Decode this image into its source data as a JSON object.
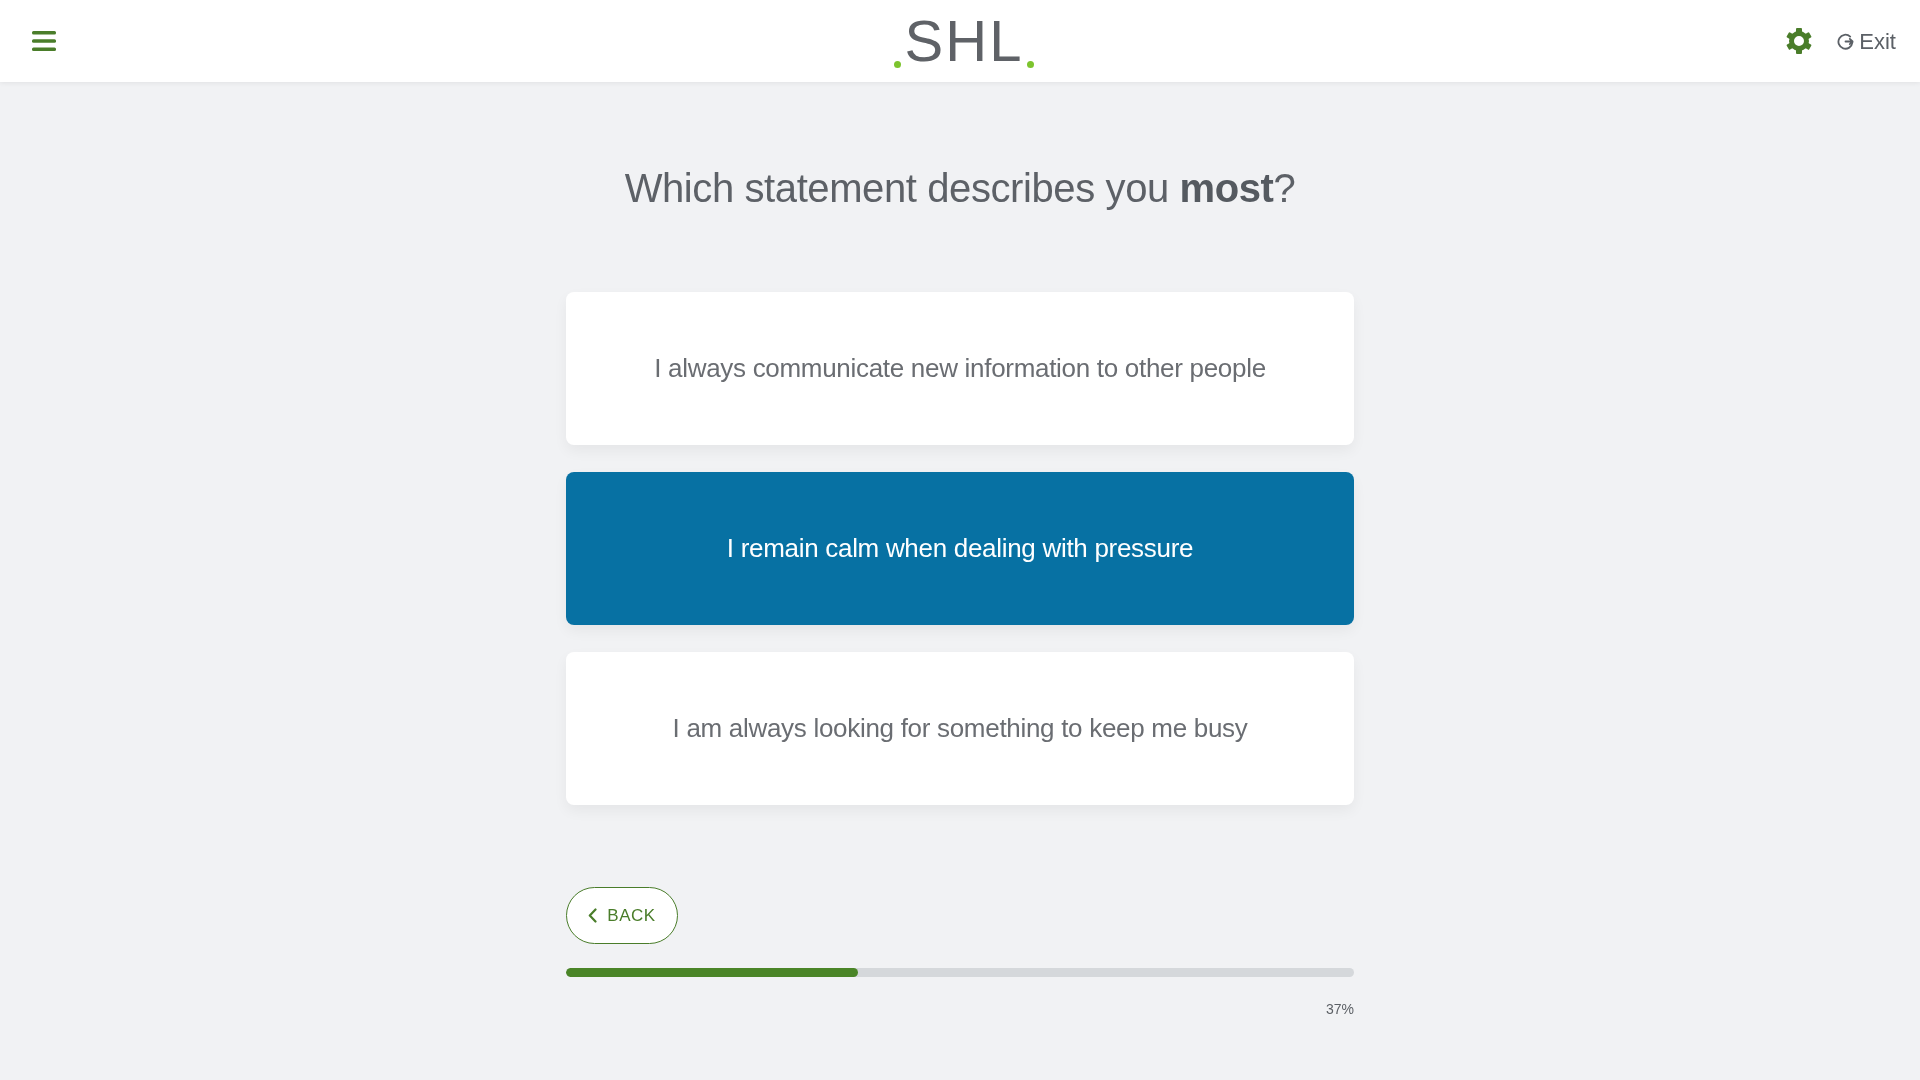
{
  "header": {
    "logo": "SHL",
    "exit_label": "Exit"
  },
  "question": "Which statement describes you **most**?",
  "options": [
    {
      "text": "I always communicate new information to other people",
      "selected": false
    },
    {
      "text": "I remain calm when dealing with pressure",
      "selected": true
    },
    {
      "text": "I am always looking for something to keep me busy",
      "selected": false
    }
  ],
  "back_button": "BACK",
  "progress": {
    "level": 0.37,
    "reading": "37%"
  }
}
